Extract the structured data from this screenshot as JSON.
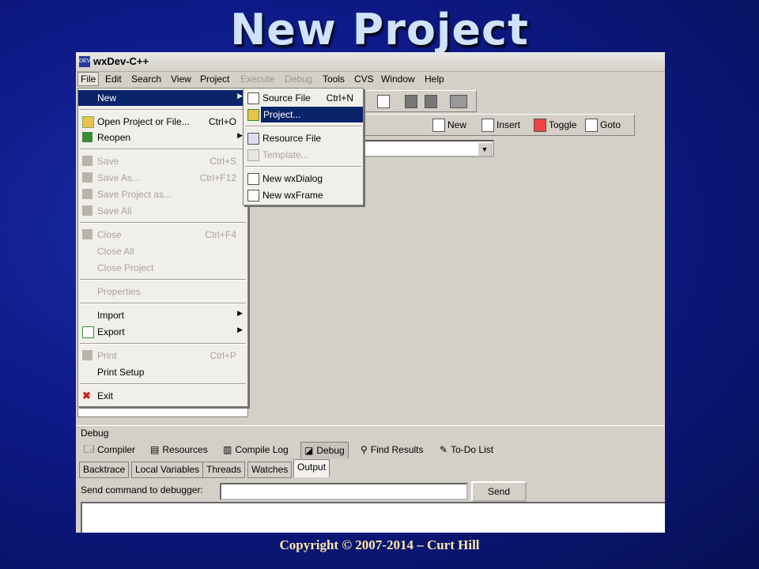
{
  "slide": {
    "title": "New Project",
    "footer": "Copyright © 2007-2014 – Curt Hill"
  },
  "window": {
    "title": "wxDev-C++",
    "icon": "wxdev-icon"
  },
  "menubar": [
    {
      "label": "File",
      "enabled": true
    },
    {
      "label": "Edit",
      "enabled": true
    },
    {
      "label": "Search",
      "enabled": true
    },
    {
      "label": "View",
      "enabled": true
    },
    {
      "label": "Project",
      "enabled": true
    },
    {
      "label": "Execute",
      "enabled": false
    },
    {
      "label": "Debug",
      "enabled": false
    },
    {
      "label": "Tools",
      "enabled": true
    },
    {
      "label": "CVS",
      "enabled": true
    },
    {
      "label": "Window",
      "enabled": true
    },
    {
      "label": "Help",
      "enabled": true
    }
  ],
  "file_menu": [
    {
      "label": "New",
      "shortcut": "",
      "submenu": true,
      "highlighted": true,
      "enabled": true
    },
    {
      "label": "Open Project or File...",
      "shortcut": "Ctrl+O",
      "icon": "open-folder-icon",
      "enabled": true
    },
    {
      "label": "Reopen",
      "shortcut": "",
      "submenu": true,
      "icon": "reopen-icon",
      "enabled": true
    },
    {
      "label": "Save",
      "shortcut": "Ctrl+S",
      "icon": "save-icon",
      "enabled": false
    },
    {
      "label": "Save As...",
      "shortcut": "Ctrl+F12",
      "icon": "save-as-icon",
      "enabled": false
    },
    {
      "label": "Save Project as...",
      "shortcut": "",
      "icon": "save-project-icon",
      "enabled": false
    },
    {
      "label": "Save All",
      "shortcut": "",
      "icon": "save-all-icon",
      "enabled": false
    },
    {
      "label": "Close",
      "shortcut": "Ctrl+F4",
      "icon": "close-file-icon",
      "enabled": false
    },
    {
      "label": "Close All",
      "shortcut": "",
      "enabled": false
    },
    {
      "label": "Close Project",
      "shortcut": "",
      "enabled": false
    },
    {
      "label": "Properties",
      "shortcut": "",
      "enabled": false
    },
    {
      "label": "Import",
      "shortcut": "",
      "submenu": true,
      "enabled": true
    },
    {
      "label": "Export",
      "shortcut": "",
      "submenu": true,
      "icon": "export-icon",
      "enabled": true
    },
    {
      "label": "Print",
      "shortcut": "Ctrl+P",
      "icon": "print-icon",
      "enabled": false
    },
    {
      "label": "Print Setup",
      "shortcut": "",
      "enabled": true
    },
    {
      "label": "Exit",
      "shortcut": "",
      "icon": "exit-icon",
      "enabled": true
    }
  ],
  "new_submenu": [
    {
      "label": "Source File",
      "shortcut": "Ctrl+N",
      "icon": "source-file-icon",
      "enabled": true
    },
    {
      "label": "Project...",
      "shortcut": "",
      "icon": "project-icon",
      "enabled": true,
      "highlighted": true
    },
    {
      "label": "Resource File",
      "shortcut": "",
      "icon": "resource-file-icon",
      "enabled": true
    },
    {
      "label": "Template...",
      "shortcut": "",
      "icon": "template-icon",
      "enabled": false
    },
    {
      "label": "New wxDialog",
      "shortcut": "",
      "icon": "wxdialog-icon",
      "enabled": true
    },
    {
      "label": "New wxFrame",
      "shortcut": "",
      "icon": "wxframe-icon",
      "enabled": true
    }
  ],
  "bookmark_toolbar": [
    {
      "label": "New",
      "icon": "new-icon"
    },
    {
      "label": "Insert",
      "icon": "insert-icon"
    },
    {
      "label": "Toggle",
      "icon": "toggle-icon"
    },
    {
      "label": "Goto",
      "icon": "goto-icon"
    }
  ],
  "bottom_panel": {
    "label": "Debug",
    "tabs": [
      {
        "label": "Compiler",
        "icon": "compiler-icon"
      },
      {
        "label": "Resources",
        "icon": "resources-icon"
      },
      {
        "label": "Compile Log",
        "icon": "compile-log-icon"
      },
      {
        "label": "Debug",
        "icon": "debug-icon",
        "active": true
      },
      {
        "label": "Find Results",
        "icon": "find-results-icon"
      },
      {
        "label": "To-Do List",
        "icon": "todo-icon"
      }
    ],
    "subtabs": [
      {
        "label": "Backtrace"
      },
      {
        "label": "Local Variables"
      },
      {
        "label": "Threads"
      },
      {
        "label": "Watches"
      },
      {
        "label": "Output",
        "active": true
      }
    ],
    "command_label": "Send command to debugger:",
    "command_value": "",
    "send_label": "Send"
  }
}
